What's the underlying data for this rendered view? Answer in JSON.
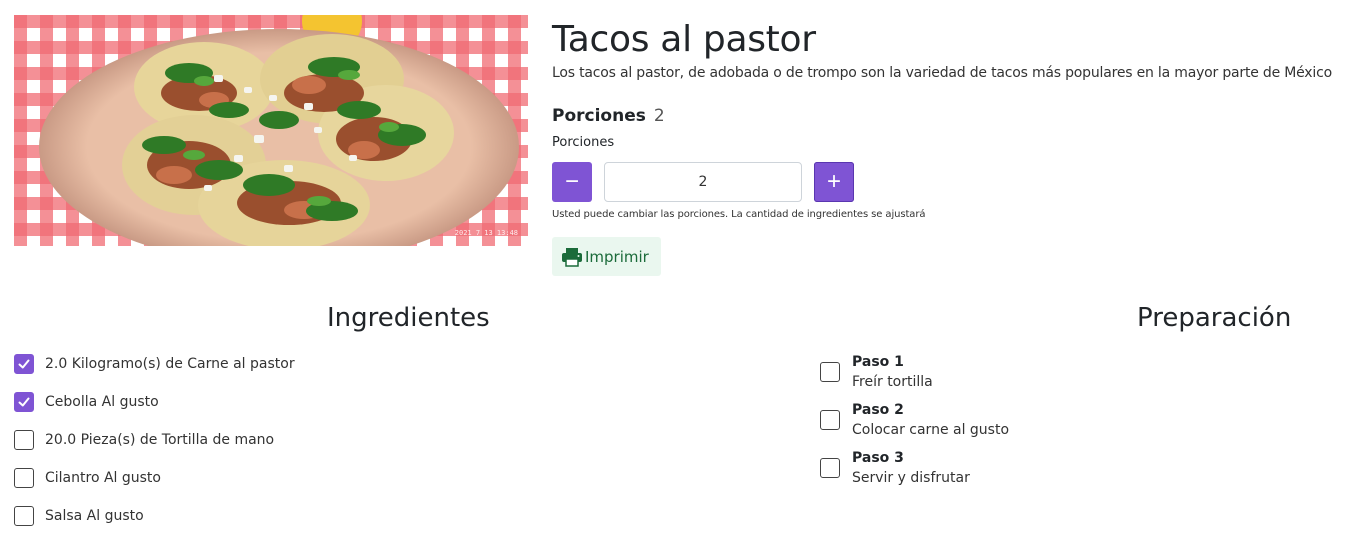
{
  "recipe": {
    "title": "Tacos al pastor",
    "description": "Los tacos al pastor, de adobada o de trompo son la variedad de tacos más populares en la mayor parte de México",
    "photo_stamp": "2021 7 13 13:48"
  },
  "portions": {
    "heading_label": "Porciones",
    "heading_value": "2",
    "field_label": "Porciones",
    "value": "2",
    "decrement_label": "−",
    "increment_label": "+",
    "help_text": "Usted puede cambiar las porciones. La cantidad de ingredientes se ajustará"
  },
  "print_button": {
    "label": "Imprimir",
    "icon": "printer-icon"
  },
  "ingredients": {
    "title": "Ingredientes",
    "items": [
      {
        "label": "2.0 Kilogramo(s) de Carne al pastor",
        "checked": true
      },
      {
        "label": "Cebolla Al gusto",
        "checked": true
      },
      {
        "label": "20.0 Pieza(s) de Tortilla de mano",
        "checked": false
      },
      {
        "label": "Cilantro Al gusto",
        "checked": false
      },
      {
        "label": "Salsa Al gusto",
        "checked": false
      }
    ]
  },
  "preparation": {
    "title": "Preparación",
    "steps": [
      {
        "step": "Paso 1",
        "text": "Freír tortilla",
        "checked": false
      },
      {
        "step": "Paso 2",
        "text": "Colocar carne al gusto",
        "checked": false
      },
      {
        "step": "Paso 3",
        "text": "Servir y disfrutar",
        "checked": false
      }
    ]
  },
  "colors": {
    "accent": "#7f54d4",
    "print_bg": "#eaf7ef",
    "print_fg": "#1b6b3a"
  }
}
